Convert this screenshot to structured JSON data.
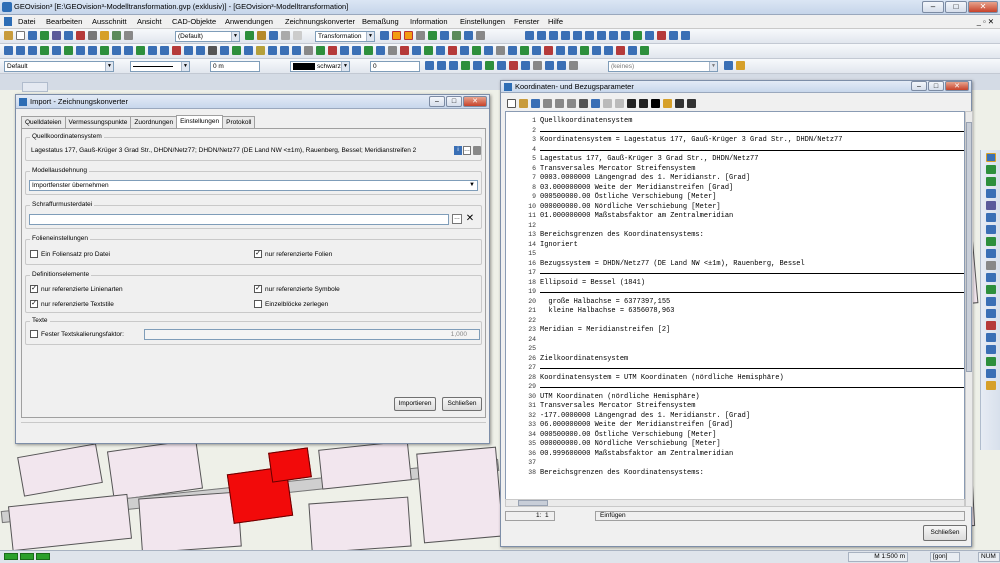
{
  "main_window": {
    "title": "GEOvision³  [E:\\GEOvision³-Modelltransformation.gvp (exklusiv)] - [GEOvision³-Modelltransformation]"
  },
  "menu": [
    "Datei",
    "Bearbeiten",
    "Ausschnitt",
    "Ansicht",
    "CAD-Objekte",
    "Anwendungen",
    "Zeichnungskonverter",
    "Bemaßung",
    "Information",
    "Einstellungen",
    "Fenster",
    "Hilfe"
  ],
  "toolbar": {
    "scale_combo": "(Default)",
    "transform_combo": "Transformation",
    "layer_combo": "Default",
    "width_value": "0 m",
    "color_combo": "schwarz",
    "number_value": "0",
    "keines_combo": "(keines)"
  },
  "import_dialog": {
    "title": "Import - Zeichnungskonverter",
    "tabs": [
      "Quelldateien",
      "Vermessungspunkte",
      "Zuordnungen",
      "Einstellungen",
      "Protokoll"
    ],
    "active_tab": "Einstellungen",
    "quellkoordinatensystem_label": "Quellkoordinatensystem",
    "quellkoordinatensystem_value": "Lagestatus 177, Gauß-Krüger 3 Grad Str., DHDN/Netz77; DHDN/Netz77 (DE Land NW <±1m), Rauenberg, Bessel; Meridianstreifen 2",
    "modellausdehnung_label": "Modellausdehnung",
    "modellausdehnung_value": "Importfenster übernehmen",
    "schraffur_label": "Schraffurmusterdatei",
    "schraffur_value": "",
    "folien_label": "Folieneinstellungen",
    "folien_opt1": "Ein Foliensatz pro Datei",
    "folien_opt2": "nur referenzierte Folien",
    "def_label": "Definitionselemente",
    "def_opt1": "nur referenzierte Linienarten",
    "def_opt2": "nur referenzierte Symbole",
    "def_opt3": "nur referenzierte Textstile",
    "def_opt4": "Einzelblöcke zerlegen",
    "texte_label": "Texte",
    "texte_opt1": "Fester Textskalierungsfaktor:",
    "texte_value": "1,000",
    "btn_import": "Importieren",
    "btn_close": "Schließen"
  },
  "coord_dialog": {
    "title": "Koordinaten- und Bezugsparameter",
    "lines": [
      {
        "n": "1",
        "t": "Quellkoordinatensystem"
      },
      {
        "n": "2",
        "t": ""
      },
      {
        "n": "3",
        "t": "Koordinatensystem = Lagestatus 177, Gauß-Krüger 3 Grad Str., DHDN/Netz77"
      },
      {
        "n": "4",
        "t": ""
      },
      {
        "n": "5",
        "t": "Lagestatus 177, Gauß-Krüger 3 Grad Str., DHDN/Netz77"
      },
      {
        "n": "6",
        "t": "Transversales Mercator Streifensystem"
      },
      {
        "n": "7",
        "t": "0003.0000000 Längengrad des 1. Meridianstr. [Grad]"
      },
      {
        "n": "8",
        "t": "03.000000000 Weite der Meridianstreifen [Grad]"
      },
      {
        "n": "9",
        "t": "000500000.00 Östliche Verschiebung [Meter]"
      },
      {
        "n": "10",
        "t": "000000000.00 Nördliche Verschiebung [Meter]"
      },
      {
        "n": "11",
        "t": "01.000000000 Maßstabsfaktor am Zentralmeridian"
      },
      {
        "n": "12",
        "t": ""
      },
      {
        "n": "13",
        "t": "Bereichsgrenzen des Koordinatensystems:"
      },
      {
        "n": "14",
        "t": "Ignoriert"
      },
      {
        "n": "15",
        "t": ""
      },
      {
        "n": "16",
        "t": "Bezugssystem = DHDN/Netz77 (DE Land NW <±1m), Rauenberg, Bessel"
      },
      {
        "n": "17",
        "t": ""
      },
      {
        "n": "18",
        "t": "Ellipsoid = Bessel (1841)"
      },
      {
        "n": "19",
        "t": ""
      },
      {
        "n": "20",
        "t": "  große Halbachse = 6377397,155"
      },
      {
        "n": "21",
        "t": "  kleine Halbachse = 6356078,963"
      },
      {
        "n": "22",
        "t": ""
      },
      {
        "n": "23",
        "t": "Meridian = Meridianstreifen [2]"
      },
      {
        "n": "24",
        "t": ""
      },
      {
        "n": "25",
        "t": ""
      },
      {
        "n": "26",
        "t": "Zielkoordinatensystem"
      },
      {
        "n": "27",
        "t": ""
      },
      {
        "n": "28",
        "t": "Koordinatensystem = UTM Koordinaten (nördliche Hemisphäre)"
      },
      {
        "n": "29",
        "t": ""
      },
      {
        "n": "30",
        "t": "UTM Koordinaten (nördliche Hemisphäre)"
      },
      {
        "n": "31",
        "t": "Transversales Mercator Streifensystem"
      },
      {
        "n": "32",
        "t": "-177.0000000 Längengrad des 1. Meridianstr. [Grad]"
      },
      {
        "n": "33",
        "t": "06.000000000 Weite der Meridianstreifen [Grad]"
      },
      {
        "n": "34",
        "t": "000500000.00 Östliche Verschiebung [Meter]"
      },
      {
        "n": "35",
        "t": "000000000.00 Nördliche Verschiebung [Meter]"
      },
      {
        "n": "36",
        "t": "00.999600000 Maßstabsfaktor am Zentralmeridian"
      },
      {
        "n": "37",
        "t": ""
      },
      {
        "n": "38",
        "t": "Bereichsgrenzen des Koordinatensystems:"
      }
    ],
    "status_pos": "1:  1",
    "status_mode": "Einfügen",
    "btn_close": "Schließen"
  },
  "statusbar": {
    "scale": "M 1:500",
    "unit": "m",
    "gon": "[gon]",
    "num": "NUM"
  }
}
